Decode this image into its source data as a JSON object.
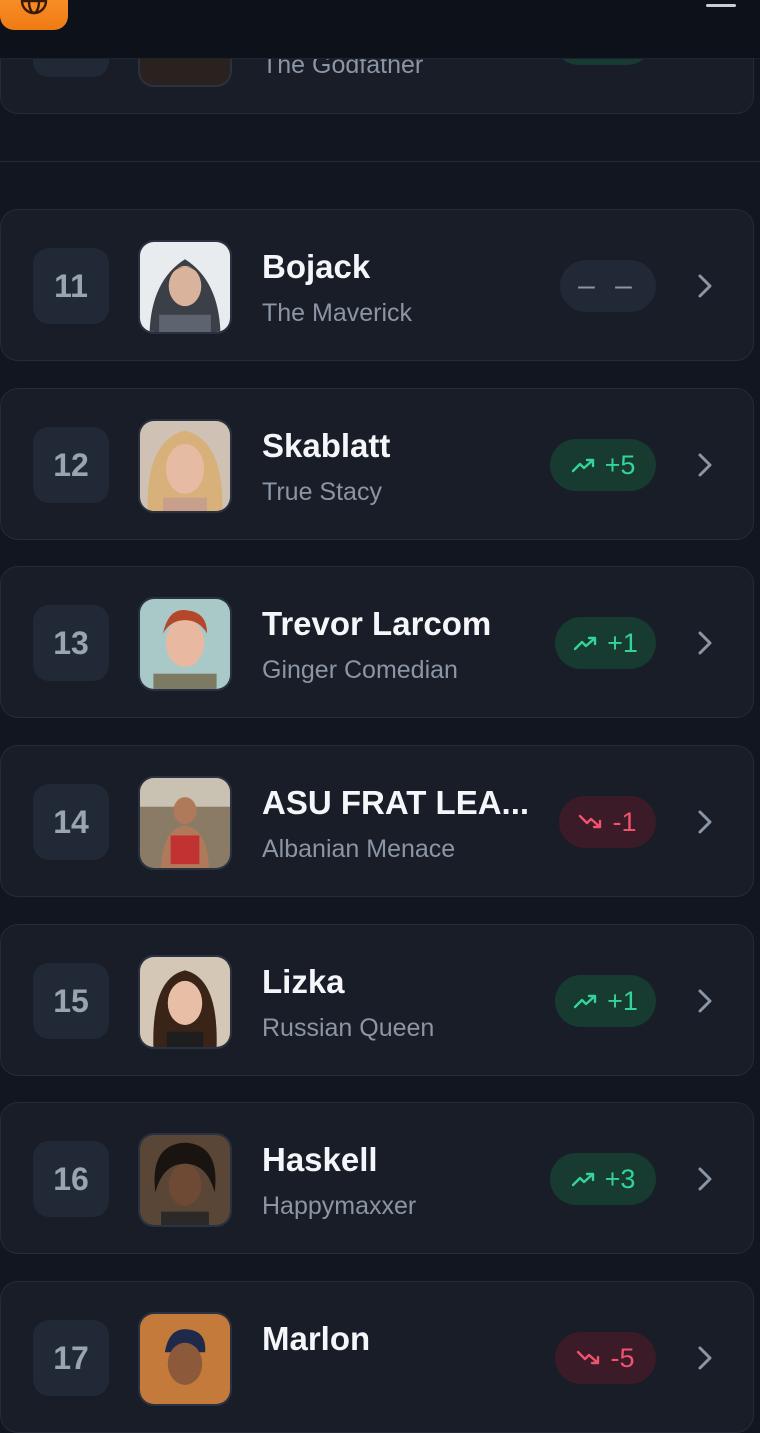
{
  "header": {
    "menu_icon": "hamburger-menu-icon",
    "app_icon": "globe-icon",
    "app_icon_color": "#f58a1f"
  },
  "colors": {
    "background": "#111620",
    "card": "#181d27",
    "up": "#34d399",
    "down": "#f0526f"
  },
  "rows": [
    {
      "rank": "",
      "name": "",
      "subtitle": "The Godfather",
      "change": "",
      "trend": "up"
    },
    {
      "rank": "11",
      "name": "Bojack",
      "subtitle": "The Maverick",
      "change": "– –",
      "trend": "none"
    },
    {
      "rank": "12",
      "name": "Skablatt",
      "subtitle": "True Stacy",
      "change": "+5",
      "trend": "up"
    },
    {
      "rank": "13",
      "name": "Trevor Larcom",
      "subtitle": "Ginger Comedian",
      "change": "+1",
      "trend": "up"
    },
    {
      "rank": "14",
      "name": "ASU FRAT LEA...",
      "subtitle": "Albanian Menace",
      "change": "-1",
      "trend": "down"
    },
    {
      "rank": "15",
      "name": "Lizka",
      "subtitle": "Russian Queen",
      "change": "+1",
      "trend": "up"
    },
    {
      "rank": "16",
      "name": "Haskell",
      "subtitle": "Happymaxxer",
      "change": "+3",
      "trend": "up"
    },
    {
      "rank": "17",
      "name": "Marlon",
      "subtitle": "",
      "change": "-5",
      "trend": "down"
    }
  ]
}
